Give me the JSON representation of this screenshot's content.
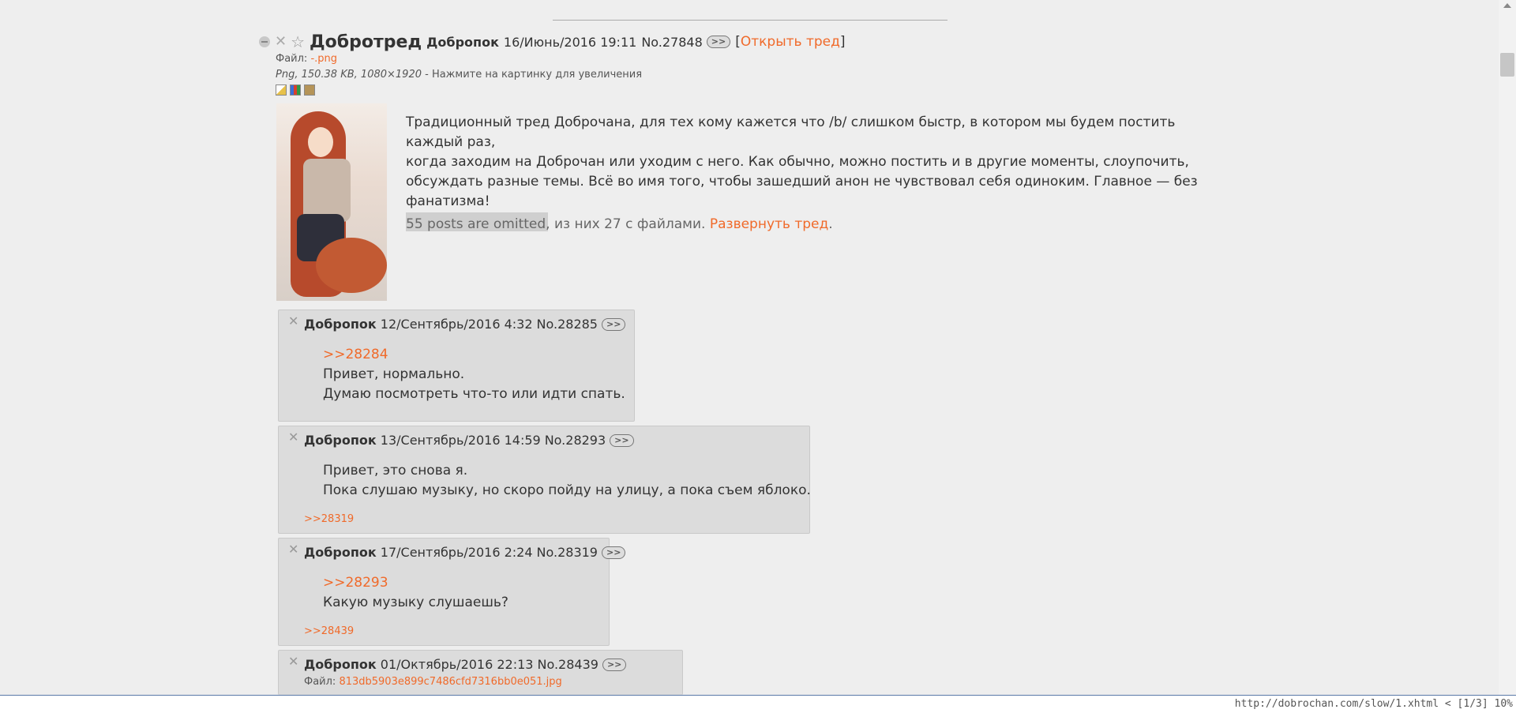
{
  "op": {
    "subject": "Добротред",
    "name": "Добропок",
    "date": "16/Июнь/2016 19:11",
    "number": "No.27848",
    "reflink_btn": ">>",
    "open_thread_label": "Открыть тред",
    "file_label": "Файл:",
    "file_name": "-.png",
    "file_details": "Png, 150.38 KB, 1080×1920",
    "file_hint": " - Нажмите на картинку для увеличения",
    "message": [
      "Традиционный тред Доброчана, для тех кому кажется что /b/ слишком быстр, в котором мы будем постить каждый раз,",
      "когда заходим на Доброчан или уходим с него. Как обычно, можно постить и в другие моменты, слоупочить,",
      "обсуждать разные темы. Всё во имя того, чтобы зашедший анон не чувствовал себя одиноким. Главное — без",
      "фанатизма!"
    ],
    "omitted_text": "55 posts are omitted, из них 27 с файлами.",
    "expand_label": "Развернуть тред",
    "expand_suffix": "."
  },
  "replies": [
    {
      "name": "Добропок",
      "date": "12/Сентябрь/2016 4:32",
      "number": "No.28285",
      "quote": ">>28284",
      "lines": [
        "Привет, нормально.",
        "Думаю посмотреть что-то или идти спать."
      ],
      "backlink": ""
    },
    {
      "name": "Добропок",
      "date": "13/Сентябрь/2016 14:59",
      "number": "No.28293",
      "quote": "",
      "lines": [
        "Привет, это снова я.",
        "Пока слушаю музыку, но скоро пойду на улицу, а пока съем яблоко."
      ],
      "backlink": ">>28319"
    },
    {
      "name": "Добропок",
      "date": "17/Сентябрь/2016 2:24",
      "number": "No.28319",
      "quote": ">>28293",
      "lines": [
        "Какую музыку слушаешь?"
      ],
      "backlink": ">>28439"
    },
    {
      "name": "Добропок",
      "date": "01/Октябрь/2016 22:13",
      "number": "No.28439",
      "file_label": "Файл:",
      "file_name": "813db5903e899c7486cfd7316bb0e051.jpg"
    }
  ],
  "statusbar": {
    "text": "http://dobrochan.com/slow/1.xhtml < [1/3] 10%"
  }
}
